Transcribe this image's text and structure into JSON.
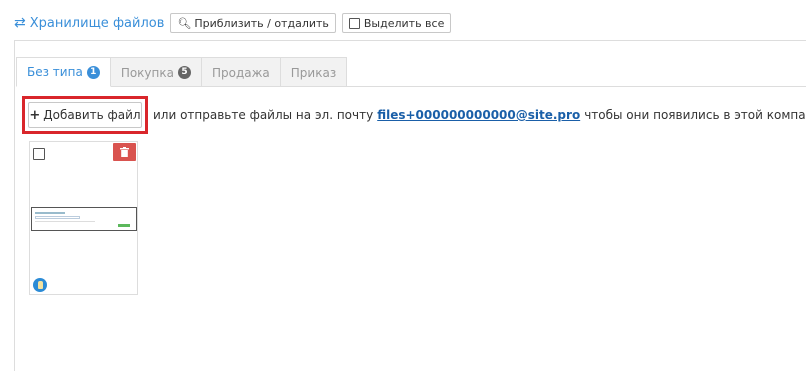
{
  "toolbar": {
    "title": "Хранилище файлов",
    "title_icon": "exchange-arrows-icon",
    "zoom_label": "Приблизить / отдалить",
    "zoom_icon": "zoom-icon",
    "select_all_label": "Выделить все"
  },
  "tabs": [
    {
      "label": "Без типа",
      "badge": "1",
      "active": true
    },
    {
      "label": "Покупка",
      "badge": "5",
      "active": false
    },
    {
      "label": "Продажа",
      "badge": "",
      "active": false
    },
    {
      "label": "Приказ",
      "badge": "",
      "active": false
    }
  ],
  "upload": {
    "add_file_label": "Добавить файл",
    "message_before": "или отправьте файлы на эл. почту",
    "email": "files+000000000000@site.pro",
    "message_after": "чтобы они появились в этой компании"
  },
  "colors": {
    "accent": "#3a8fd9",
    "highlight_border": "#d9262b",
    "delete": "#d9534f"
  }
}
